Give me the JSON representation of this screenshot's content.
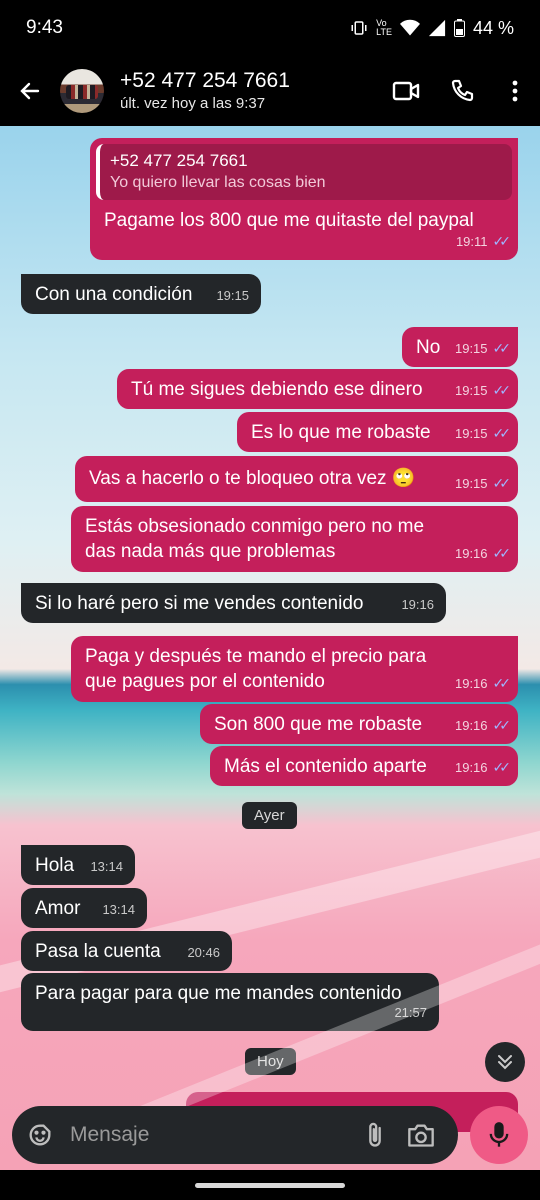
{
  "status": {
    "time": "9:43",
    "battery": "44 %",
    "network": "LTE",
    "carrier_mark": "Vo"
  },
  "header": {
    "name": "+52 477 254 7661",
    "last_seen": "últ. vez hoy a las 9:37"
  },
  "quote": {
    "name": "+52 477 254 7661",
    "text": "Yo quiero llevar las cosas bien"
  },
  "messages": [
    {
      "dir": "out",
      "text": "Pagame los 800 que me quitaste del paypal",
      "time": "19:11",
      "read": true
    },
    {
      "dir": "in",
      "text": "Con una condición",
      "time": "19:15"
    },
    {
      "dir": "out",
      "text": "No",
      "time": "19:15",
      "read": true
    },
    {
      "dir": "out",
      "text": "Tú me sigues debiendo ese dinero",
      "time": "19:15",
      "read": true
    },
    {
      "dir": "out",
      "text": "Es lo que me robaste",
      "time": "19:15",
      "read": true
    },
    {
      "dir": "out",
      "text": "Vas a hacerlo o te bloqueo otra vez 🙄",
      "time": "19:15",
      "read": true
    },
    {
      "dir": "out",
      "text": "Estás obsesionado conmigo pero no me das nada más que problemas",
      "time": "19:16",
      "read": true
    },
    {
      "dir": "in",
      "text": "Si lo haré pero si me vendes contenido",
      "time": "19:16"
    },
    {
      "dir": "out",
      "text": "Paga y después te mando el precio para que pagues por el contenido",
      "time": "19:16",
      "read": true
    },
    {
      "dir": "out",
      "text": "Son 800 que me robaste",
      "time": "19:16",
      "read": true
    },
    {
      "dir": "out",
      "text": "Más el contenido aparte",
      "time": "19:16",
      "read": true
    },
    {
      "dir": "in",
      "text": "Hola",
      "time": "13:14"
    },
    {
      "dir": "in",
      "text": "Amor",
      "time": "13:14"
    },
    {
      "dir": "in",
      "text": "Pasa la cuenta",
      "time": "20:46"
    },
    {
      "dir": "in",
      "text": "Para pagar para que me mandes contenido",
      "time": "21:57"
    }
  ],
  "days": {
    "yesterday": "Ayer",
    "today": "Hoy"
  },
  "composer": {
    "placeholder": "Mensaje"
  },
  "icons": [
    "back-arrow-icon",
    "video-call-icon",
    "phone-icon",
    "more-vert-icon",
    "sticker-icon",
    "attach-icon",
    "camera-icon",
    "mic-icon",
    "scroll-down-icon"
  ],
  "colors": {
    "outgoing": "#c41f5b",
    "incoming": "#232629",
    "mic": "#ef5a86",
    "ticks": "#9fb6ff"
  }
}
